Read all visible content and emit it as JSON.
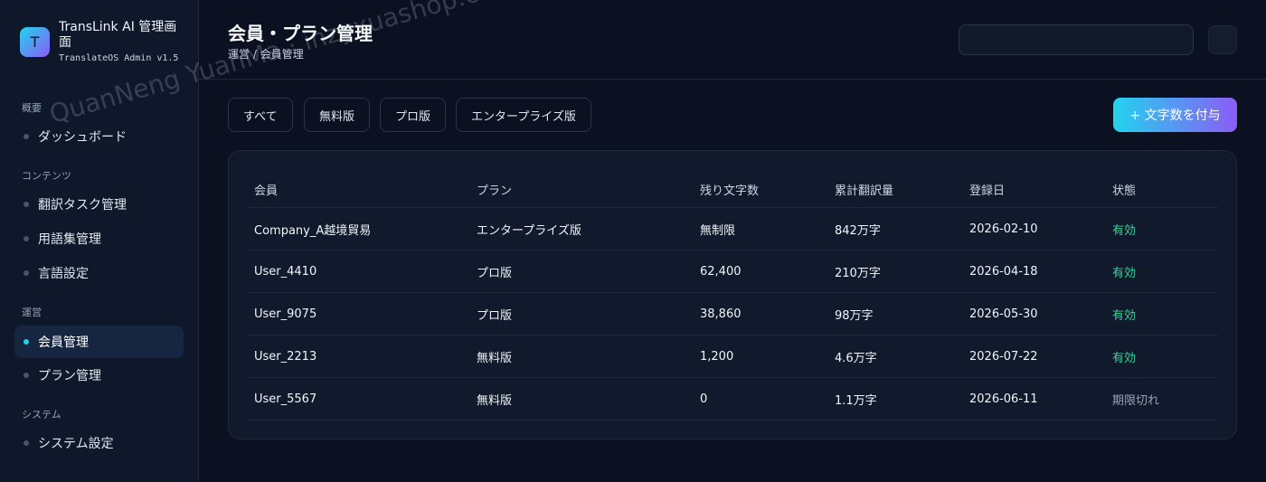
{
  "brand": {
    "logo_letter": "T",
    "title": "TransLink AI 管理画面",
    "subtitle": "TranslateOS Admin v1.5"
  },
  "sidebar": {
    "sections": [
      {
        "label": "概要",
        "items": [
          {
            "label": "ダッシュボード"
          }
        ]
      },
      {
        "label": "コンテンツ",
        "items": [
          {
            "label": "翻訳タスク管理"
          },
          {
            "label": "用語集管理"
          },
          {
            "label": "言語設定"
          }
        ]
      },
      {
        "label": "運営",
        "items": [
          {
            "label": "会員管理",
            "active": true
          },
          {
            "label": "プラン管理"
          }
        ]
      },
      {
        "label": "システム",
        "items": [
          {
            "label": "システム設定"
          }
        ]
      }
    ]
  },
  "header": {
    "title": "会員・プラン管理",
    "breadcrumb": "運営 / 会員管理",
    "search_value": ""
  },
  "filters": [
    "すべて",
    "無料版",
    "プロ版",
    "エンタープライズ版"
  ],
  "primary_action": "+ 文字数を付与",
  "table": {
    "columns": [
      "会員",
      "プラン",
      "残り文字数",
      "累計翻訳量",
      "登録日",
      "状態"
    ],
    "rows": [
      [
        "Company_A越境貿易",
        "エンタープライズ版",
        "無制限",
        "842万字",
        "2026-02-10",
        "有効"
      ],
      [
        "User_4410",
        "プロ版",
        "62,400",
        "210万字",
        "2026-04-18",
        "有効"
      ],
      [
        "User_9075",
        "プロ版",
        "38,860",
        "98万字",
        "2026-05-30",
        "有効"
      ],
      [
        "User_2213",
        "無料版",
        "1,200",
        "4.6万字",
        "2026-07-22",
        "有効"
      ],
      [
        "User_5567",
        "無料版",
        "0",
        "1.1万字",
        "2026-06-11",
        "期限切れ"
      ]
    ]
  },
  "watermark": "QuanNeng YuanMa · inzyxuashop.com",
  "colors": {
    "accent_cyan": "#22d3ee",
    "accent_violet": "#8b5cf6",
    "status_active": "#34d399",
    "status_expired": "#94a3b8",
    "background": "#0b1120"
  }
}
